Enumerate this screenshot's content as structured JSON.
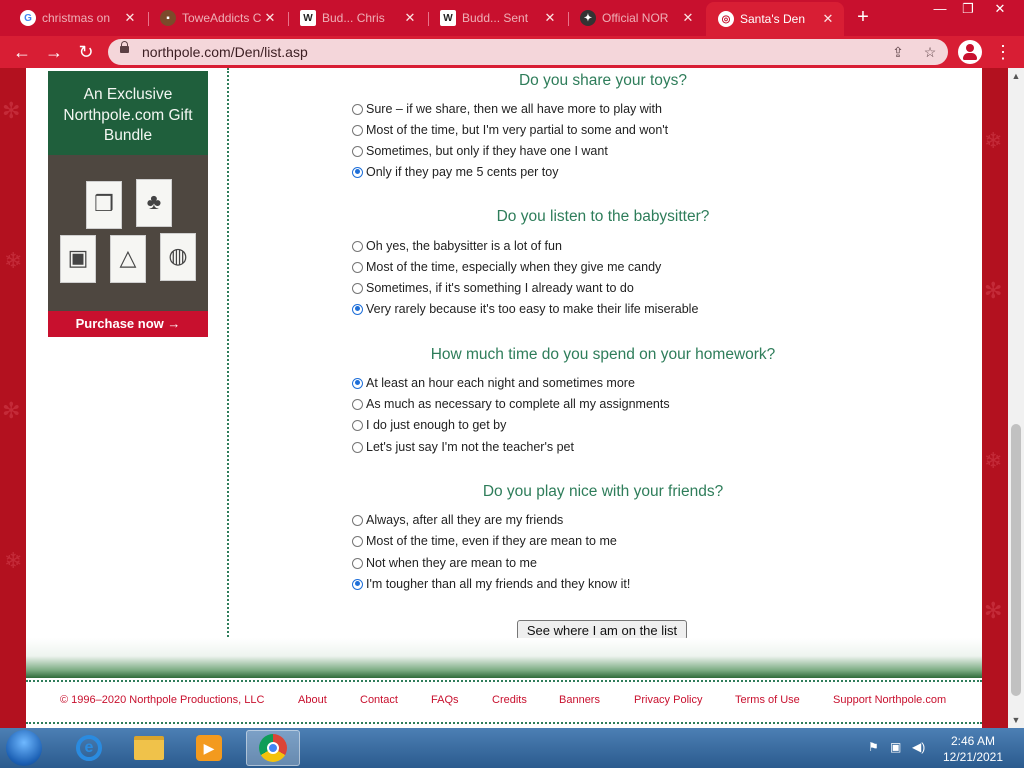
{
  "browser": {
    "tabs": [
      {
        "label": "christmas on",
        "favicon": "google-icon"
      },
      {
        "label": "ToweAddicts C",
        "favicon": "site-icon"
      },
      {
        "label": "Bud... Chris",
        "favicon": "wikipedia-icon"
      },
      {
        "label": "Budd... Sent",
        "favicon": "wikipedia-icon"
      },
      {
        "label": "Official NOR",
        "favicon": "site-icon"
      },
      {
        "label": "Santa's Den",
        "favicon": "globe-icon"
      }
    ],
    "url": "northpole.com/Den/list.asp"
  },
  "ad": {
    "text": "An Exclusive Northpole.com Gift Bundle",
    "button": "Purchase now →"
  },
  "questions": [
    {
      "title": "Do you share your toys?",
      "options": [
        {
          "label": "Sure – if we share, then we all have more to play with",
          "checked": false
        },
        {
          "label": "Most of the time, but I'm very partial to some and won't",
          "checked": false
        },
        {
          "label": "Sometimes, but only if they have one I want",
          "checked": false
        },
        {
          "label": "Only if they pay me 5 cents per toy",
          "checked": true
        }
      ]
    },
    {
      "title": "Do you listen to the babysitter?",
      "options": [
        {
          "label": "Oh yes, the babysitter is a lot of fun",
          "checked": false
        },
        {
          "label": "Most of the time, especially when they give me candy",
          "checked": false
        },
        {
          "label": "Sometimes, if it's something I already want to do",
          "checked": false
        },
        {
          "label": "Very rarely because it's too easy to make their life miserable",
          "checked": true
        }
      ]
    },
    {
      "title": "How much time do you spend on your homework?",
      "options": [
        {
          "label": "At least an hour each night and sometimes more",
          "checked": true
        },
        {
          "label": "As much as necessary to complete all my assignments",
          "checked": false
        },
        {
          "label": "I do just enough to get by",
          "checked": false
        },
        {
          "label": "Let's just say I'm not the teacher's pet",
          "checked": false
        }
      ]
    },
    {
      "title": "Do you play nice with your friends?",
      "options": [
        {
          "label": "Always, after all they are my friends",
          "checked": false
        },
        {
          "label": "Most of the time, even if they are mean to me",
          "checked": false
        },
        {
          "label": "Not when they are mean to me",
          "checked": false
        },
        {
          "label": "I'm tougher than all my friends and they know it!",
          "checked": true
        }
      ]
    }
  ],
  "submit_label": "See where I am on the list",
  "footer": {
    "copyright": "© 1996–2020 Northpole Productions, LLC",
    "links": [
      "About",
      "Contact",
      "FAQs",
      "Credits",
      "Banners",
      "Privacy Policy",
      "Terms of Use",
      "Support Northpole.com"
    ]
  },
  "taskbar": {
    "time": "2:46 AM",
    "date": "12/21/2021"
  },
  "colors": {
    "brand_red": "#c8102e",
    "heading_green": "#2e7d5a",
    "radio_checked": "#1e6fd9"
  }
}
